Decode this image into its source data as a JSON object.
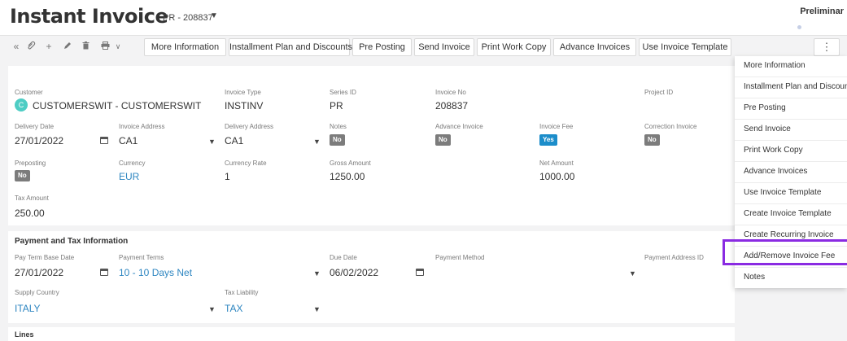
{
  "header": {
    "title": "Instant Invoice",
    "doc_number": "PR - 208837",
    "status": "Preliminar"
  },
  "toolbar": {
    "icons": [
      "double-chevron-left-icon",
      "paperclip-icon",
      "plus-icon",
      "pencil-icon",
      "trash-icon",
      "print-icon",
      "chevron-down-icon"
    ],
    "buttons": [
      "More Information",
      "Installment Plan and Discounts",
      "Pre Posting",
      "Send Invoice",
      "Print Work Copy",
      "Advance Invoices",
      "Use Invoice Template"
    ],
    "more_label": "⋮"
  },
  "form": {
    "customer": {
      "label": "Customer",
      "avatar": "C",
      "value": "CUSTOMERSWIT - CUSTOMERSWIT"
    },
    "invoice_type": {
      "label": "Invoice Type",
      "value": "INSTINV"
    },
    "series_id": {
      "label": "Series ID",
      "value": "PR"
    },
    "invoice_no": {
      "label": "Invoice No",
      "value": "208837"
    },
    "project_id": {
      "label": "Project ID",
      "value": ""
    },
    "delivery_date": {
      "label": "Delivery Date",
      "value": "27/01/2022"
    },
    "invoice_address": {
      "label": "Invoice Address",
      "value": "CA1"
    },
    "delivery_address": {
      "label": "Delivery Address",
      "value": "CA1"
    },
    "notes": {
      "label": "Notes",
      "value": "No"
    },
    "advance_invoice": {
      "label": "Advance Invoice",
      "value": "No"
    },
    "invoice_fee": {
      "label": "Invoice Fee",
      "value": "Yes"
    },
    "correction_invoice": {
      "label": "Correction Invoice",
      "value": "No"
    },
    "preposting": {
      "label": "Preposting",
      "value": "No"
    },
    "currency": {
      "label": "Currency",
      "value": "EUR"
    },
    "currency_rate": {
      "label": "Currency Rate",
      "value": "1"
    },
    "gross_amount": {
      "label": "Gross Amount",
      "value": "1250.00"
    },
    "net_amount": {
      "label": "Net Amount",
      "value": "1000.00"
    },
    "tax_amount": {
      "label": "Tax Amount",
      "value": "250.00"
    }
  },
  "payment": {
    "title": "Payment and Tax Information",
    "pay_term_base_date": {
      "label": "Pay Term Base Date",
      "value": "27/01/2022"
    },
    "payment_terms": {
      "label": "Payment Terms",
      "value": "10 - 10 Days Net"
    },
    "due_date": {
      "label": "Due Date",
      "value": "06/02/2022"
    },
    "payment_method": {
      "label": "Payment Method",
      "value": ""
    },
    "payment_address_id": {
      "label": "Payment Address ID",
      "value": ""
    },
    "supply_country": {
      "label": "Supply Country",
      "value": "ITALY"
    },
    "tax_liability": {
      "label": "Tax Liability",
      "value": "TAX"
    }
  },
  "lines": {
    "title": "Lines"
  },
  "menu": {
    "items": [
      "More Information",
      "Installment Plan and Discounts",
      "Pre Posting",
      "Send Invoice",
      "Print Work Copy",
      "Advance Invoices",
      "Use Invoice Template",
      "Create Invoice Template",
      "Create Recurring Invoice",
      "Add/Remove Invoice Fee",
      "Notes"
    ],
    "highlight_color": "#8a2be2"
  }
}
